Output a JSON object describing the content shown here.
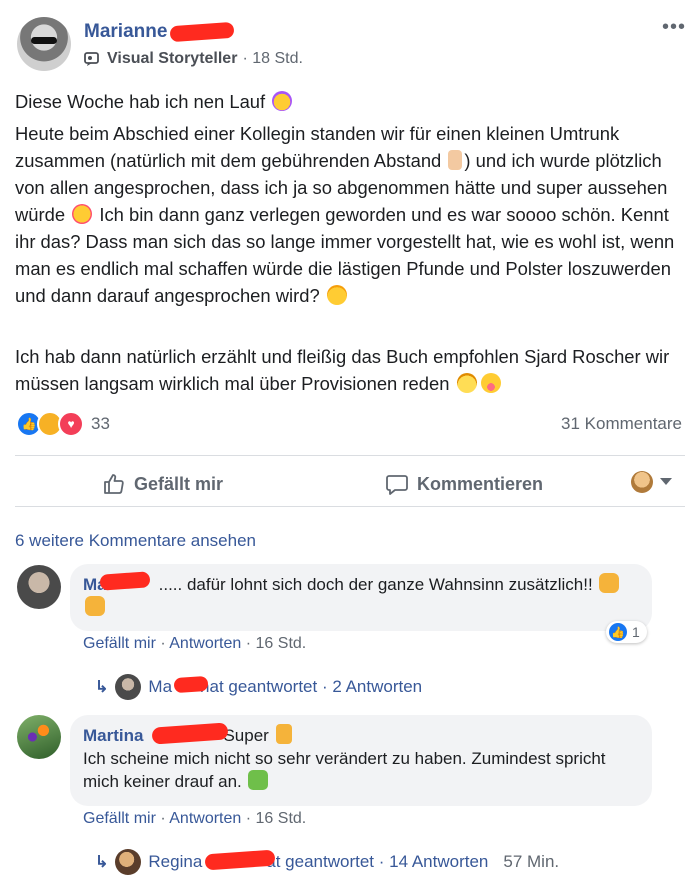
{
  "post": {
    "author_name": "Marianne",
    "author_role": "Visual Storyteller",
    "timestamp": "· 18 Std.",
    "headline": "Diese Woche hab ich nen Lauf",
    "paragraph1": {
      "part1": "Heute beim Abschied einer Kollegin standen wir für einen kleinen Umtrunk zusammen (natürlich mit dem gebührenden Abstand",
      "part2": ") und ich wurde plötzlich von allen angesprochen, dass ich ja so abgenommen hätte und super aussehen würde",
      "part3": "Ich bin dann ganz verlegen geworden und es war soooo schön. Kennt ihr das? Dass man sich das so lange immer vorgestellt hat, wie es wohl ist, wenn man es endlich mal schaffen würde die lästigen Pfunde und Polster loszuwerden und dann darauf angesprochen wird?"
    },
    "paragraph2": "Ich hab dann natürlich erzählt und fleißig das Buch empfohlen Sjard Roscher wir müssen langsam wirklich mal über Provisionen reden",
    "reaction_count": "33",
    "comment_count": "31 Kommentare"
  },
  "actions": {
    "like_label": "Gefällt mir",
    "comment_label": "Kommentieren"
  },
  "more_comments": "6 weitere Kommentare ansehen",
  "comments": [
    {
      "name": "Ma",
      "text": "..... dafür lohnt sich doch der ganze Wahnsinn zusätzlich!!",
      "like_label": "Gefällt mir",
      "reply_label": "Antworten",
      "time": "· 16 Std.",
      "likes": "1",
      "reply_name_start": "Ma",
      "reply_summary": "hat geantwortet · 2 Antworten"
    },
    {
      "name": "Martina",
      "text_inline": "Super",
      "text": "Ich scheine mich nicht so sehr verändert zu haben. Zumindest spricht mich keiner drauf an.",
      "like_label": "Gefällt mir",
      "reply_label": "Antworten",
      "time": "· 16 Std.",
      "reply_name_start": "Regina",
      "reply_summary": "at geantwortet · 14 Antworten",
      "reply_time": "57 Min."
    }
  ],
  "colors": {
    "link": "#385898",
    "muted": "#606770",
    "bubble": "#f2f3f5",
    "like_blue": "#1877f2",
    "redaction": "#ff2a1f"
  }
}
